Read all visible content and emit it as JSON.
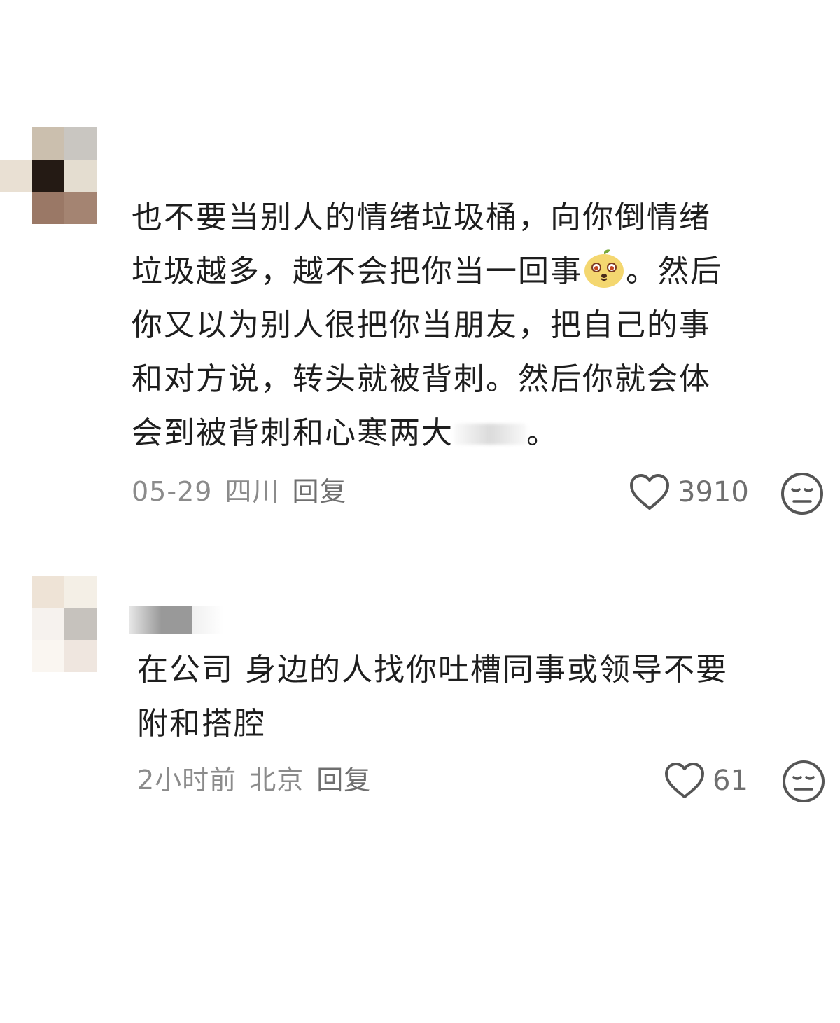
{
  "comments": [
    {
      "avatar_icon": "pixelated-avatar-icon",
      "text_before_emoji": "也不要当别人的情绪垃圾桶，向你倒情绪\n垃圾越多，越不会把你当一回事",
      "emoji": "cute-face-emoji-icon",
      "text_after_emoji": "。然后\n你又以为别人很把你当朋友，把自己的事\n和对方说，转头就被背刺。然后你就会体\n会到被背刺和心寒两大",
      "text_end": "。",
      "date": "05-29",
      "location": "四川",
      "reply_label": "回复",
      "like_count": "3910",
      "like_icon": "heart-icon",
      "dislike_icon": "meh-face-icon"
    },
    {
      "avatar_icon": "pixelated-avatar-icon",
      "text": "在公司 身边的人找你吐槽同事或领导不要\n附和搭腔",
      "date": "2小时前",
      "location": "北京",
      "reply_label": "回复",
      "like_count": "61",
      "like_icon": "heart-icon",
      "dislike_icon": "meh-face-icon"
    }
  ]
}
